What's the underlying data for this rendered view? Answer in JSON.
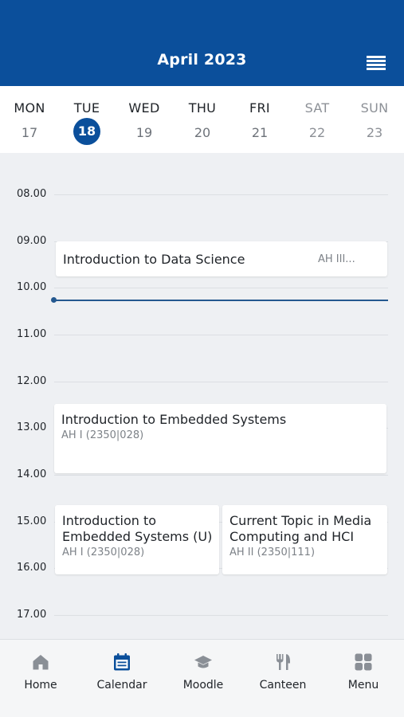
{
  "header": {
    "title": "April 2023",
    "menu_icon": "list-icon"
  },
  "week": {
    "days": [
      {
        "name": "MON",
        "num": "17"
      },
      {
        "name": "TUE",
        "num": "18"
      },
      {
        "name": "WED",
        "num": "19"
      },
      {
        "name": "THU",
        "num": "20"
      },
      {
        "name": "FRI",
        "num": "21"
      },
      {
        "name": "SAT",
        "num": "22"
      },
      {
        "name": "SUN",
        "num": "23"
      }
    ],
    "selected_day": "18"
  },
  "timeline": {
    "hours": [
      "08.00",
      "09.00",
      "10.00",
      "11.00",
      "12.00",
      "13.00",
      "14.00",
      "15.00",
      "16.00",
      "17.00"
    ]
  },
  "events": [
    {
      "title": "Introduction to Data Science",
      "room": "AH III..."
    },
    {
      "title": "Introduction to Embedded Systems",
      "room": "AH I (2350|028)"
    },
    {
      "title_line1": "Introduction to",
      "title_line2": "Embedded Systems (U)",
      "room": "AH I (2350|028)"
    },
    {
      "title_line1": "Current Topic in Media",
      "title_line2": "Computing and HCI",
      "room": "AH II (2350|111)"
    }
  ],
  "nav": [
    {
      "label": "Home",
      "icon": "home-icon"
    },
    {
      "label": "Calendar",
      "icon": "calendar-icon"
    },
    {
      "label": "Moodle",
      "icon": "graduation-cap-icon"
    },
    {
      "label": "Canteen",
      "icon": "fork-knife-icon"
    },
    {
      "label": "Menu",
      "icon": "grid-icon"
    }
  ],
  "colors": {
    "primary": "#0b4f9b",
    "background": "#eef0f3",
    "now_line": "#24588f",
    "icon_gray": "#8a8f96"
  }
}
